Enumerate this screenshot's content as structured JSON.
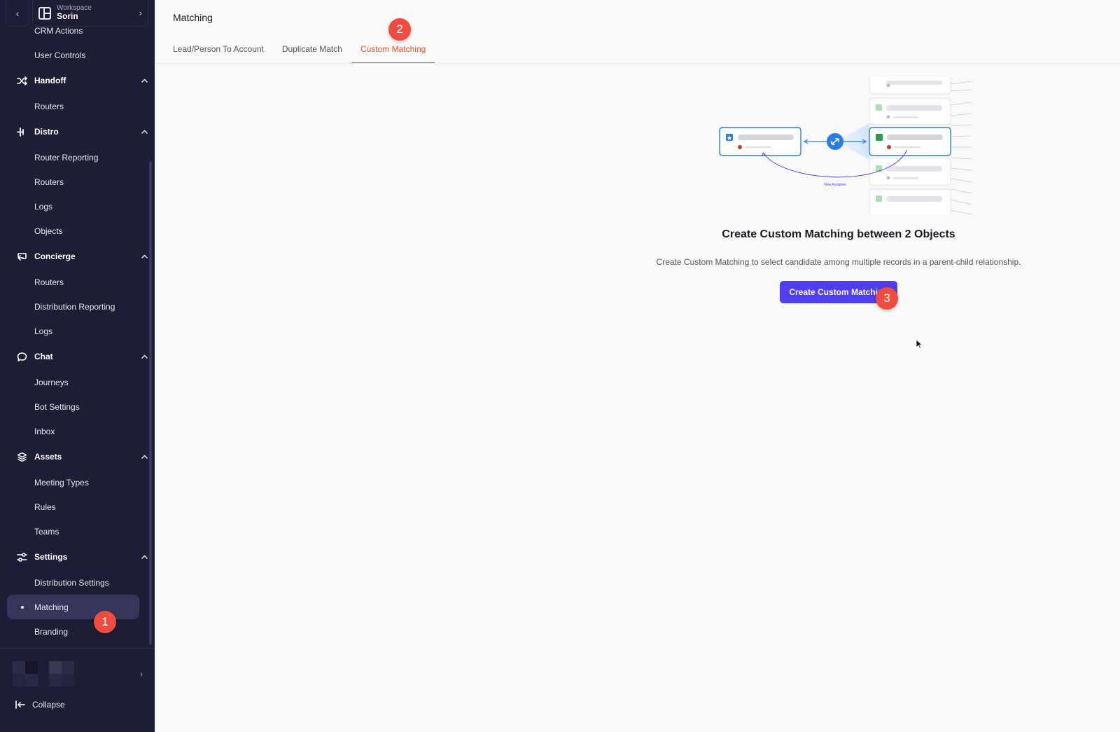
{
  "workspace": {
    "label": "Workspace",
    "name": "Sorin"
  },
  "sidebar": {
    "items": [
      {
        "type": "sub",
        "label": "CRM Actions"
      },
      {
        "type": "sub",
        "label": "User Controls"
      },
      {
        "type": "group",
        "label": "Handoff",
        "icon": "shuffle-icon"
      },
      {
        "type": "sub",
        "label": "Routers"
      },
      {
        "type": "group",
        "label": "Distro",
        "icon": "branch-icon"
      },
      {
        "type": "sub",
        "label": "Router Reporting"
      },
      {
        "type": "sub",
        "label": "Routers"
      },
      {
        "type": "sub",
        "label": "Logs"
      },
      {
        "type": "sub",
        "label": "Objects"
      },
      {
        "type": "group",
        "label": "Concierge",
        "icon": "concierge-icon"
      },
      {
        "type": "sub",
        "label": "Routers"
      },
      {
        "type": "sub",
        "label": "Distribution Reporting"
      },
      {
        "type": "sub",
        "label": "Logs"
      },
      {
        "type": "group",
        "label": "Chat",
        "icon": "chat-bubble-icon"
      },
      {
        "type": "sub",
        "label": "Journeys"
      },
      {
        "type": "sub",
        "label": "Bot Settings"
      },
      {
        "type": "sub",
        "label": "Inbox"
      },
      {
        "type": "group",
        "label": "Assets",
        "icon": "layers-icon"
      },
      {
        "type": "sub",
        "label": "Meeting Types"
      },
      {
        "type": "sub",
        "label": "Rules"
      },
      {
        "type": "sub",
        "label": "Teams"
      },
      {
        "type": "group",
        "label": "Settings",
        "icon": "sliders-icon"
      },
      {
        "type": "sub",
        "label": "Distribution Settings"
      },
      {
        "type": "active",
        "label": "Matching"
      },
      {
        "type": "sub",
        "label": "Branding"
      }
    ],
    "collapse_label": "Collapse"
  },
  "main": {
    "title": "Matching",
    "tabs": [
      {
        "label": "Lead/Person To Account",
        "active": false
      },
      {
        "label": "Duplicate Match",
        "active": false
      },
      {
        "label": "Custom Matching",
        "active": true
      }
    ],
    "empty_state": {
      "illustration_caption": "New Assignee",
      "title": "Create Custom Matching between 2 Objects",
      "description": "Create Custom Matching to select candidate among multiple records in a parent-child relationship.",
      "button_label": "Create Custom Matching"
    }
  },
  "markers": [
    "1",
    "2",
    "3"
  ],
  "colors": {
    "sidebar_bg": "#1e1d36",
    "active_tab": "#f0522a",
    "primary_button": "#4f3df0",
    "marker": "#ef4b3f",
    "link_blue": "#2a7de1"
  }
}
